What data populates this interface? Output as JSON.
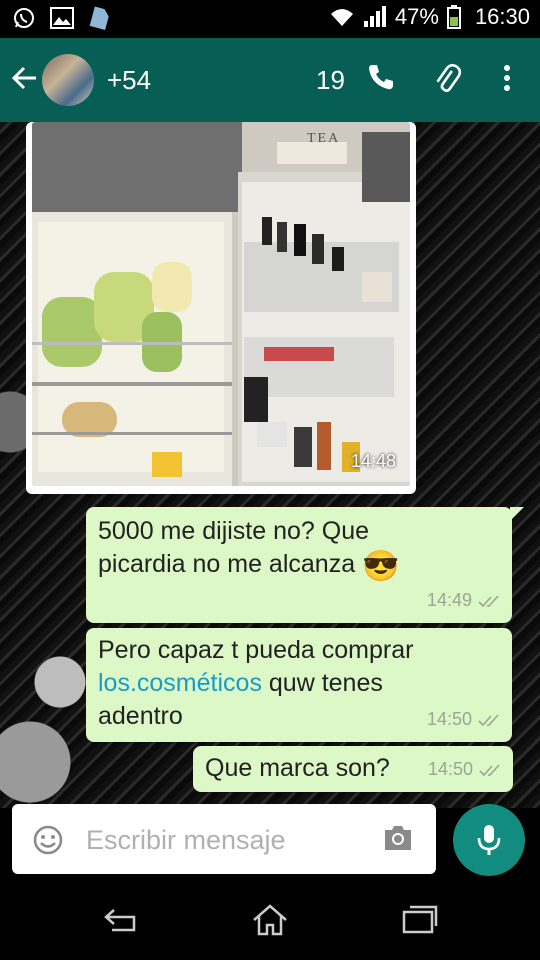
{
  "status_bar": {
    "battery": "47%",
    "time": "16:30"
  },
  "header": {
    "contact_name": "+54",
    "unread_count": "19"
  },
  "messages": {
    "image": {
      "time": "14:48",
      "label": "TEA"
    },
    "m1": {
      "line1": "5000 me dijiste no? Que",
      "line2": "picardia no me alcanza",
      "emoji": "😎",
      "time": "14:49"
    },
    "m2": {
      "line1": "Pero capaz t pueda comprar",
      "link": "los.cosméticos",
      "line2_rest": " quw tenes",
      "line3": "adentro",
      "time": "14:50"
    },
    "m3": {
      "text": "Que marca son?",
      "time": "14:50"
    }
  },
  "composer": {
    "placeholder": "Escribir mensaje"
  },
  "colors": {
    "header": "#075e54",
    "bubble_out": "#dcf8c6",
    "fab": "#128c7e",
    "link": "#1a9bc7"
  }
}
